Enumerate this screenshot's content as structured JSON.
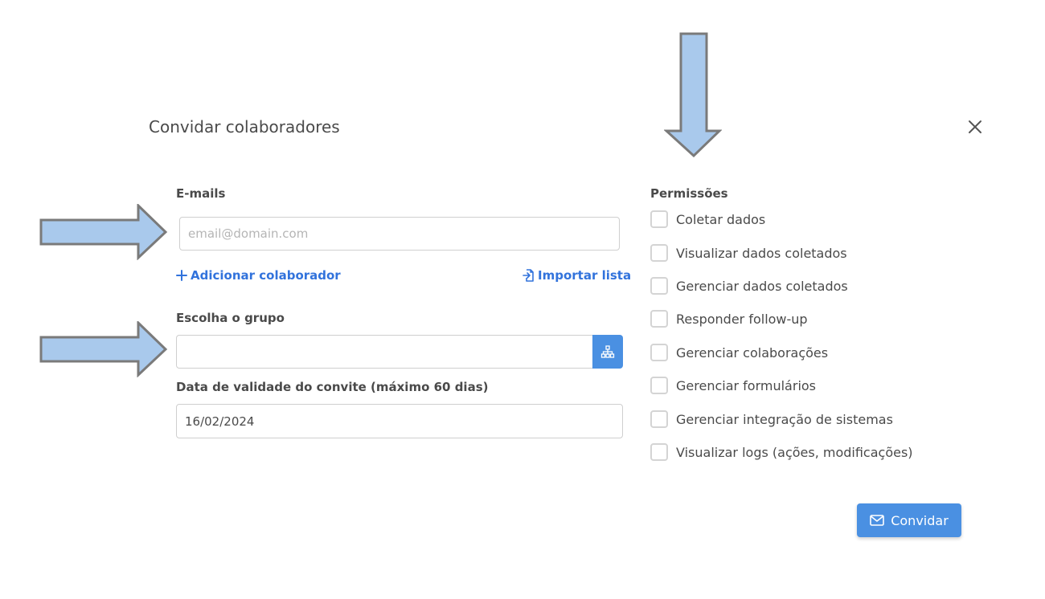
{
  "dialog": {
    "title": "Convidar colaboradores"
  },
  "emails": {
    "label": "E-mails",
    "placeholder": "email@domain.com",
    "add_label": "Adicionar colaborador",
    "import_label": "Importar lista"
  },
  "group": {
    "label": "Escolha o grupo",
    "value": ""
  },
  "expiry": {
    "label": "Data de validade do convite (máximo 60 dias)",
    "value": "16/02/2024"
  },
  "permissions": {
    "label": "Permissões",
    "items": [
      {
        "label": "Coletar dados",
        "checked": false
      },
      {
        "label": "Visualizar dados coletados",
        "checked": false
      },
      {
        "label": "Gerenciar dados coletados",
        "checked": false
      },
      {
        "label": "Responder follow-up",
        "checked": false
      },
      {
        "label": "Gerenciar colaborações",
        "checked": false
      },
      {
        "label": "Gerenciar formulários",
        "checked": false
      },
      {
        "label": "Gerenciar integração de sistemas",
        "checked": false
      },
      {
        "label": "Visualizar logs (ações, modificações)",
        "checked": false
      }
    ]
  },
  "actions": {
    "invite_label": "Convidar"
  },
  "colors": {
    "primary": "#4a90e2",
    "link": "#3273dc",
    "arrow_fill": "#a9c9ec",
    "arrow_stroke": "#7a7a7a"
  },
  "icons": {
    "close": "close-icon",
    "add": "plus-icon",
    "import": "import-file-icon",
    "group": "hierarchy-icon",
    "invite": "envelope-icon"
  }
}
